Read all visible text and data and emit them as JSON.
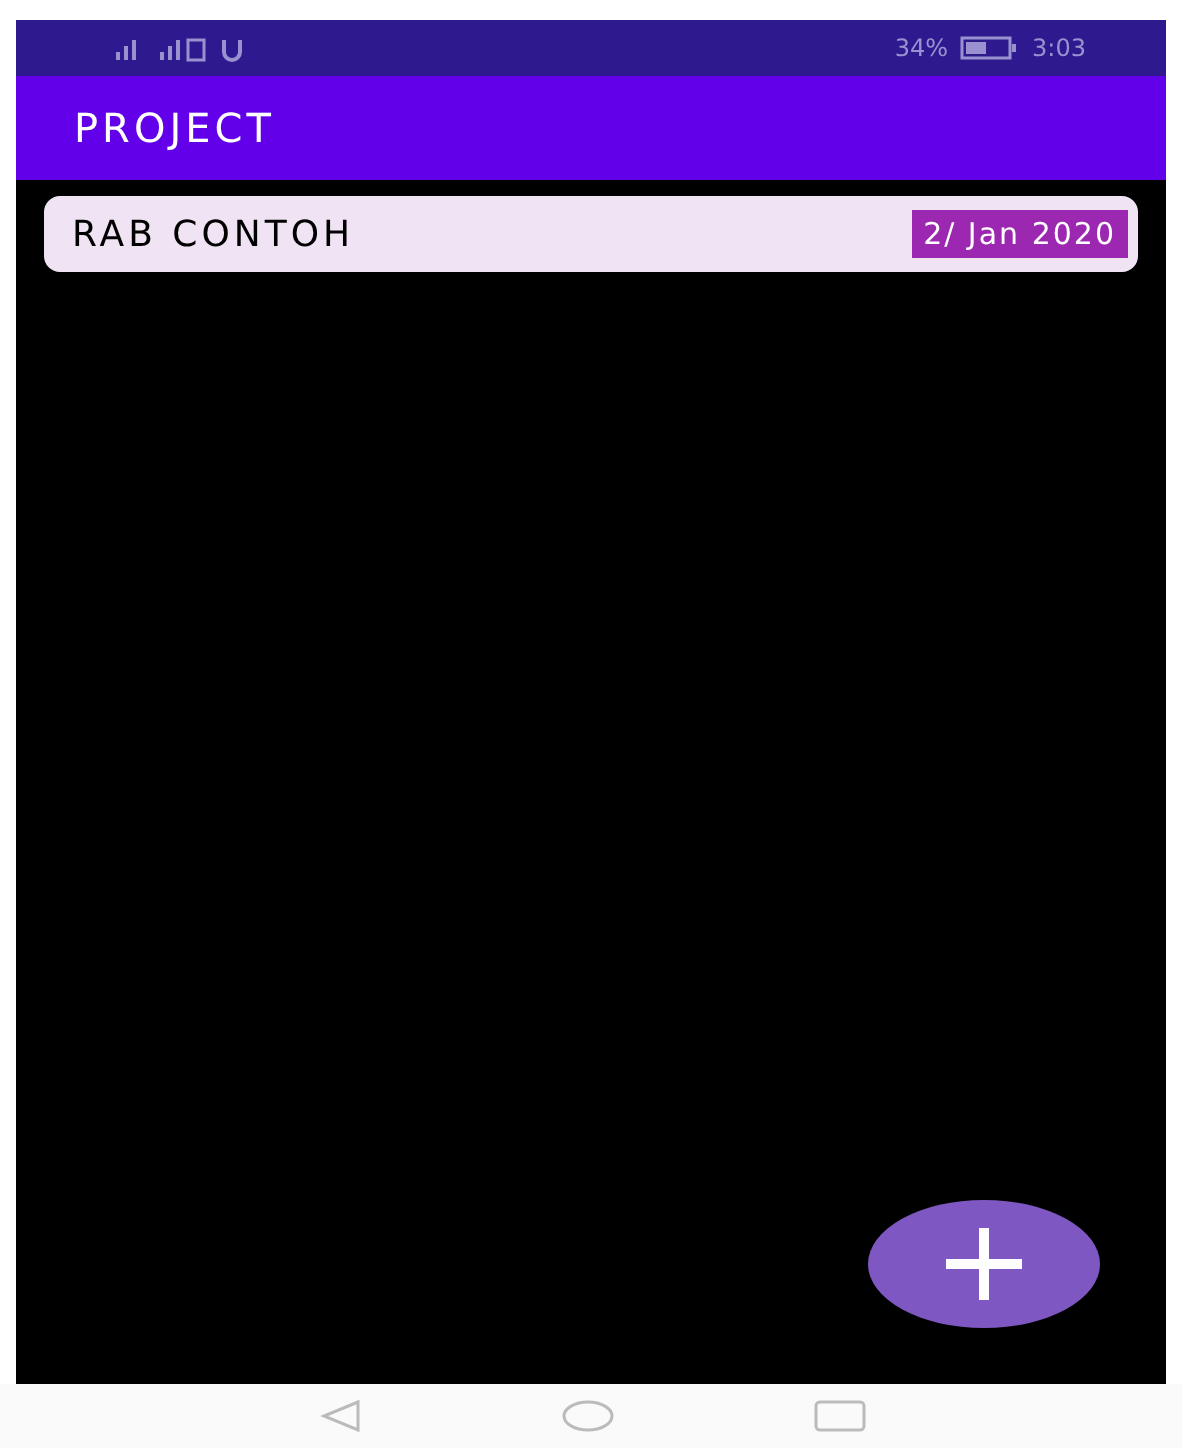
{
  "status_bar": {
    "battery": "34%",
    "time": "3:03"
  },
  "app_bar": {
    "title": "PROJECT"
  },
  "projects": [
    {
      "name": "RAB CONTOH",
      "date": "2/ Jan 2020"
    }
  ]
}
